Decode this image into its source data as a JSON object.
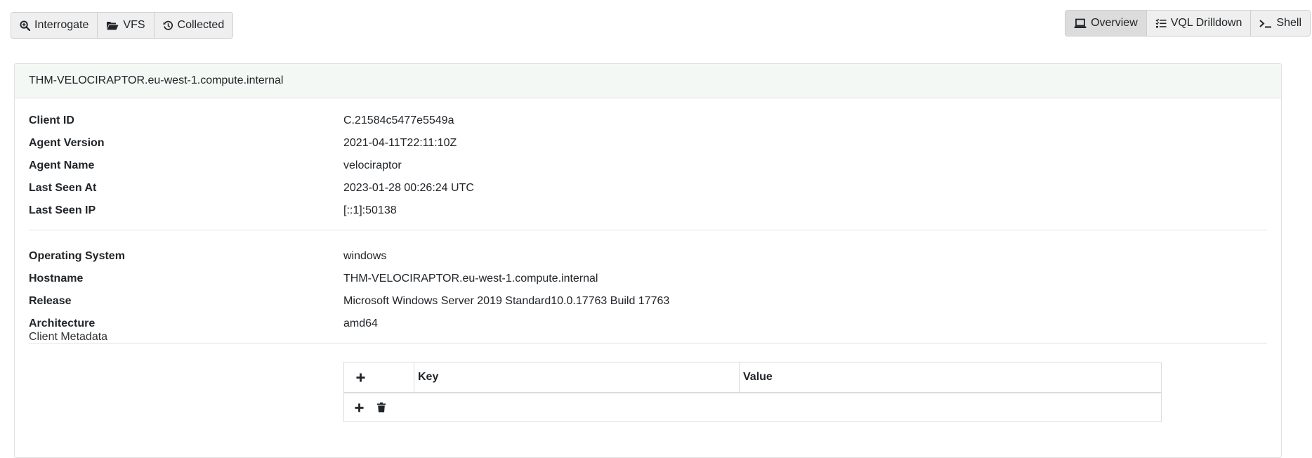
{
  "toolbar_left": {
    "interrogate": "Interrogate",
    "vfs": "VFS",
    "collected": "Collected"
  },
  "toolbar_right": {
    "overview": "Overview",
    "vql_drilldown": "VQL Drilldown",
    "shell": "Shell"
  },
  "card": {
    "title": "THM-VELOCIRAPTOR.eu-west-1.compute.internal",
    "agent_info": [
      {
        "label": "Client ID",
        "value": "C.21584c5477e5549a"
      },
      {
        "label": "Agent Version",
        "value": "2021-04-11T22:11:10Z"
      },
      {
        "label": "Agent Name",
        "value": "velociraptor"
      },
      {
        "label": "Last Seen At",
        "value": "2023-01-28 00:26:24 UTC"
      },
      {
        "label": "Last Seen IP",
        "value": "[::1]:50138"
      }
    ],
    "os_info": [
      {
        "label": "Operating System",
        "value": "windows"
      },
      {
        "label": "Hostname",
        "value": "THM-VELOCIRAPTOR.eu-west-1.compute.internal"
      },
      {
        "label": "Release",
        "value": "Microsoft Windows Server 2019 Standard10.0.17763 Build 17763"
      },
      {
        "label": "Architecture",
        "value": "amd64"
      }
    ],
    "metadata": {
      "label": "Client Metadata",
      "col_key": "Key",
      "col_value": "Value"
    }
  },
  "icons": {
    "interrogate": "search-plus-icon",
    "vfs": "folder-open-icon",
    "collected": "history-icon",
    "overview": "laptop-icon",
    "vql_drilldown": "tasks-icon",
    "shell": "terminal-icon",
    "add": "plus-icon",
    "delete": "trash-icon"
  }
}
